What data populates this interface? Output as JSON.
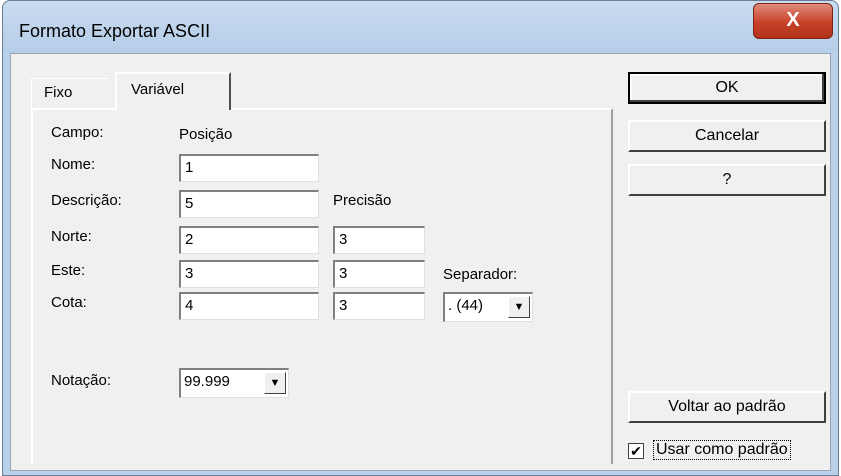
{
  "window": {
    "title": "Formato Exportar ASCII",
    "close_label": "X"
  },
  "tabs": [
    {
      "label": "Fixo"
    },
    {
      "label": "Variável"
    }
  ],
  "panel": {
    "campo_label": "Campo:",
    "posicao_label": "Posição",
    "precisao_label": "Precisão",
    "separador_label": "Separador:",
    "rows": [
      {
        "label": "Nome:",
        "posicao": "1",
        "precisao": ""
      },
      {
        "label": "Descrição:",
        "posicao": "5",
        "precisao": ""
      },
      {
        "label": "Norte:",
        "posicao": "2",
        "precisao": "3"
      },
      {
        "label": "Este:",
        "posicao": "3",
        "precisao": "3"
      },
      {
        "label": "Cota:",
        "posicao": "4",
        "precisao": "3"
      }
    ],
    "separador_value": ". (44)",
    "notacao_label": "Notação:",
    "notacao_value": "99.999"
  },
  "buttons": {
    "ok": "OK",
    "cancelar": "Cancelar",
    "help": "?",
    "voltar": "Voltar ao padrão"
  },
  "checkbox": {
    "label": "Usar como padrão",
    "checked": true,
    "mark": "✔"
  },
  "icons": {
    "arrow": "▼"
  }
}
